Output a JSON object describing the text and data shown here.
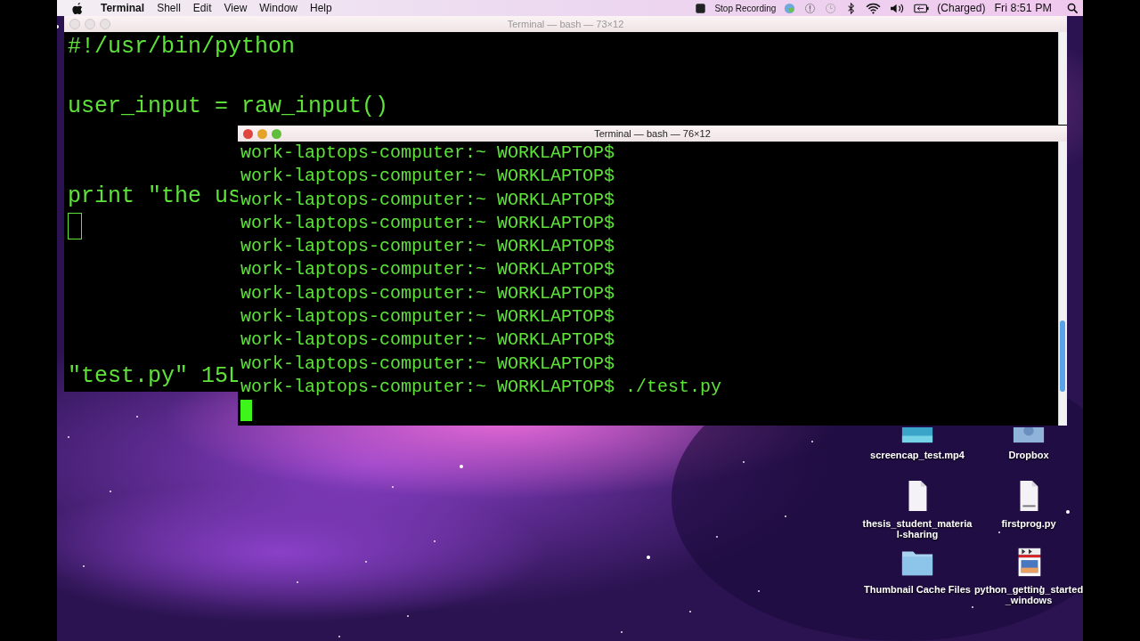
{
  "menu_bar": {
    "app": "Terminal",
    "menus": [
      "Shell",
      "Edit",
      "View",
      "Window",
      "Help"
    ],
    "recording": "Stop Recording",
    "battery": "(Charged)",
    "clock": "Fri 8:51 PM"
  },
  "windows": [
    {
      "title": "Terminal — bash — 73×12",
      "active": false,
      "lines": [
        {
          "kind": "text",
          "text": "#!/usr/bin/python"
        },
        {
          "kind": "blank"
        },
        {
          "kind": "text",
          "text": "user_input = raw_input()"
        },
        {
          "kind": "blank"
        },
        {
          "kind": "blank"
        },
        {
          "kind": "text",
          "text": "print \"the us"
        },
        {
          "kind": "cursor"
        },
        {
          "kind": "blank"
        },
        {
          "kind": "blank"
        },
        {
          "kind": "blank"
        },
        {
          "kind": "blank"
        },
        {
          "kind": "text",
          "text": "\"test.py\" 15L"
        }
      ]
    },
    {
      "title": "Terminal — bash — 76×12",
      "active": true,
      "lines": [
        {
          "kind": "text",
          "text": "work-laptops-computer:~ WORKLAPTOP$"
        },
        {
          "kind": "text",
          "text": "work-laptops-computer:~ WORKLAPTOP$"
        },
        {
          "kind": "text",
          "text": "work-laptops-computer:~ WORKLAPTOP$"
        },
        {
          "kind": "text",
          "text": "work-laptops-computer:~ WORKLAPTOP$"
        },
        {
          "kind": "text",
          "text": "work-laptops-computer:~ WORKLAPTOP$"
        },
        {
          "kind": "text",
          "text": "work-laptops-computer:~ WORKLAPTOP$"
        },
        {
          "kind": "text",
          "text": "work-laptops-computer:~ WORKLAPTOP$"
        },
        {
          "kind": "text",
          "text": "work-laptops-computer:~ WORKLAPTOP$"
        },
        {
          "kind": "text",
          "text": "work-laptops-computer:~ WORKLAPTOP$"
        },
        {
          "kind": "text",
          "text": "work-laptops-computer:~ WORKLAPTOP$"
        },
        {
          "kind": "text",
          "text": "work-laptops-computer:~ WORKLAPTOP$ ./test.py"
        },
        {
          "kind": "cursor"
        }
      ]
    }
  ],
  "desktop_icons": [
    {
      "label": "screencap_test.mp4",
      "kind": "video"
    },
    {
      "label": "Dropbox",
      "kind": "dropbox"
    },
    {
      "label": "thesis_student_material-sharing",
      "kind": "document"
    },
    {
      "label": "firstprog.py",
      "kind": "python"
    },
    {
      "label": "Thumbnail Cache Files",
      "kind": "folder"
    },
    {
      "label": "python_getting_started_windows",
      "kind": "movie"
    }
  ]
}
